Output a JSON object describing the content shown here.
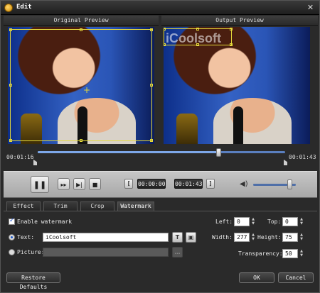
{
  "window": {
    "title": "Edit",
    "close": "✕"
  },
  "preview": {
    "original_label": "Original Preview",
    "output_label": "Output Preview",
    "watermark_overlay": "iCoolsoft"
  },
  "timeline": {
    "start_time": "00:01:16",
    "end_time": "00:01:43",
    "position_percent": 73
  },
  "controls": {
    "pause": "❚❚",
    "next_frame": "▸▸",
    "step": "▶|",
    "stop": "■",
    "start_bracket": "[",
    "start_value": "00:00:00",
    "end_value": "00:01:43",
    "end_bracket": "]",
    "volume_icon": "◀)",
    "volume_percent": 85
  },
  "tabs": [
    "Effect",
    "Trim",
    "Crop",
    "Watermark"
  ],
  "active_tab": "Watermark",
  "watermark": {
    "enable_label": "Enable watermark",
    "enabled": true,
    "text_label": "Text:",
    "text_value": "iCoolsoft",
    "text_font_btn": "T",
    "text_color_btn": "▣",
    "picture_label": "Picture:",
    "picture_browse": "…",
    "left_label": "Left:",
    "left_value": "0",
    "top_label": "Top:",
    "top_value": "0",
    "width_label": "Width:",
    "width_value": "277",
    "height_label": "Height:",
    "height_value": "75",
    "transparency_label": "Transparency:",
    "transparency_value": "50"
  },
  "footer": {
    "restore": "Restore Defaults",
    "ok": "OK",
    "cancel": "Cancel"
  },
  "colors": {
    "selection": "#e4d93a",
    "accent": "#1a56c8"
  }
}
